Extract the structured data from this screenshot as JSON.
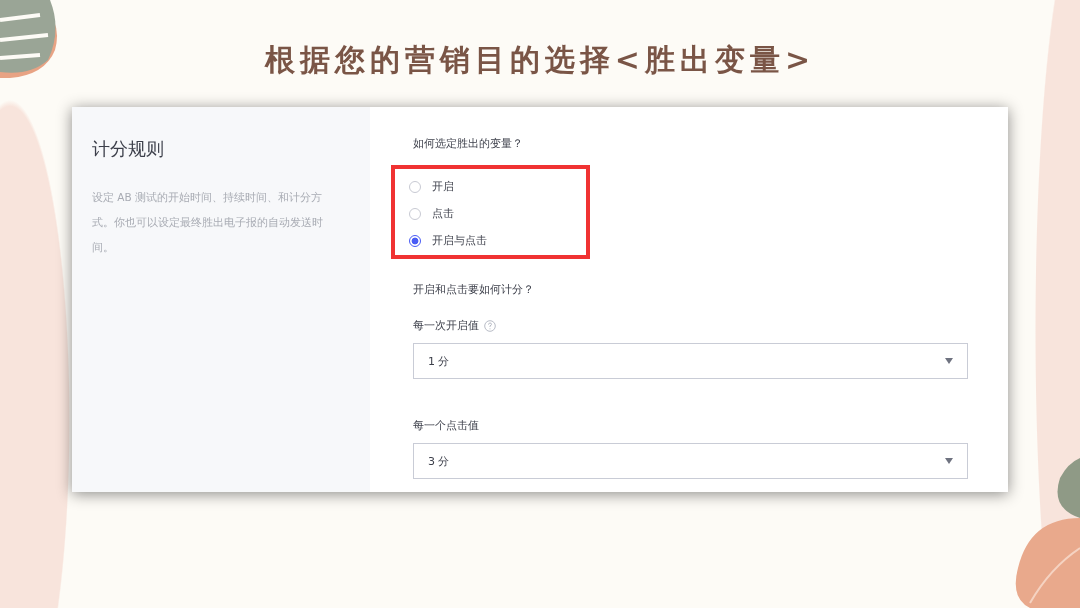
{
  "slide_title": "根据您的营销目的选择<胜出变量>",
  "sidebar": {
    "title": "计分规则",
    "description": "设定 AB 测试的开始时间、持续时间、和计分方式。你也可以设定最终胜出电子报的自动发送时间。"
  },
  "winner_question": "如何选定胜出的变量？",
  "options": [
    {
      "label": "开启",
      "selected": false
    },
    {
      "label": "点击",
      "selected": false
    },
    {
      "label": "开启与点击",
      "selected": true
    }
  ],
  "scoring_question": "开启和点击要如何计分？",
  "fields": [
    {
      "label": "每一次开启值",
      "help": true,
      "value": "1 分"
    },
    {
      "label": "每一个点击值",
      "help": false,
      "value": "3 分"
    }
  ]
}
